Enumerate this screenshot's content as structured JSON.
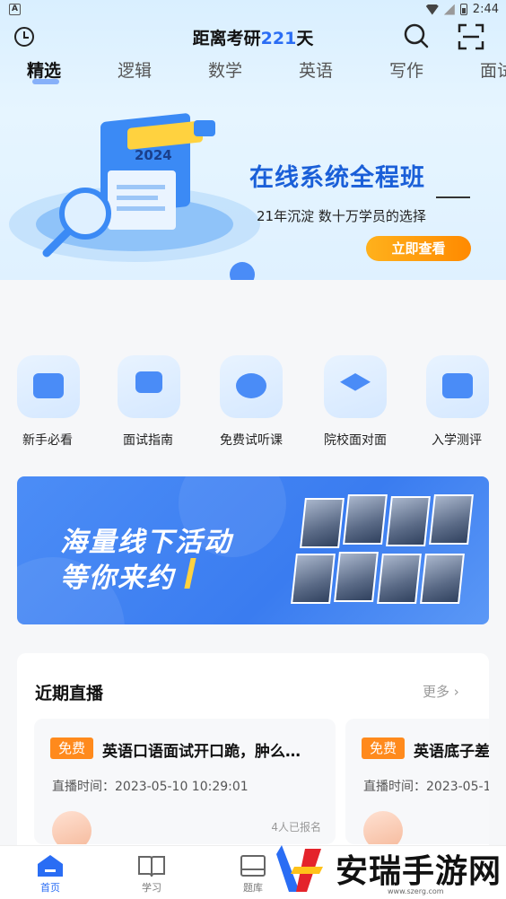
{
  "status_bar": {
    "time": "2:44",
    "left_icon": "A"
  },
  "header": {
    "countdown_prefix": "距离考研",
    "countdown_days": "221",
    "countdown_suffix": "天"
  },
  "tabs": [
    "精选",
    "逻辑",
    "数学",
    "英语",
    "写作",
    "面试"
  ],
  "banner": {
    "year": "2024",
    "title": "在线系统全程班",
    "subtitle": "21年沉淀 数十万学员的选择",
    "button": "立即查看"
  },
  "quick_entries": [
    {
      "label": "新手必看",
      "icon": "video-icon"
    },
    {
      "label": "面试指南",
      "icon": "screen-play-icon"
    },
    {
      "label": "免费试听课",
      "icon": "chat-play-icon"
    },
    {
      "label": "院校面对面",
      "icon": "graduation-cap-icon"
    },
    {
      "label": "入学测评",
      "icon": "clock-board-icon"
    }
  ],
  "activity": {
    "line1": "海量线下活动",
    "line2": "等你来约"
  },
  "live": {
    "title": "近期直播",
    "more": "更多",
    "items": [
      {
        "tag": "免费",
        "name": "英语口语面试开口跪，肿么…",
        "time": "直播时间：2023-05-10 10:29:01",
        "count": "4人已报名"
      },
      {
        "tag": "免费",
        "name": "英语底子差",
        "time": "直播时间：2023-05-1",
        "count": ""
      }
    ]
  },
  "bottom_nav": [
    {
      "label": "首页",
      "icon": "home-icon"
    },
    {
      "label": "学习",
      "icon": "book-icon"
    },
    {
      "label": "题库",
      "icon": "question-bank-icon"
    }
  ],
  "watermark": {
    "text": "安瑞手游网",
    "url": "www.szerg.com"
  },
  "colors": {
    "accent": "#2a6df4",
    "orange": "#ff8a1c",
    "banner_blue": "#1a5fd8"
  }
}
